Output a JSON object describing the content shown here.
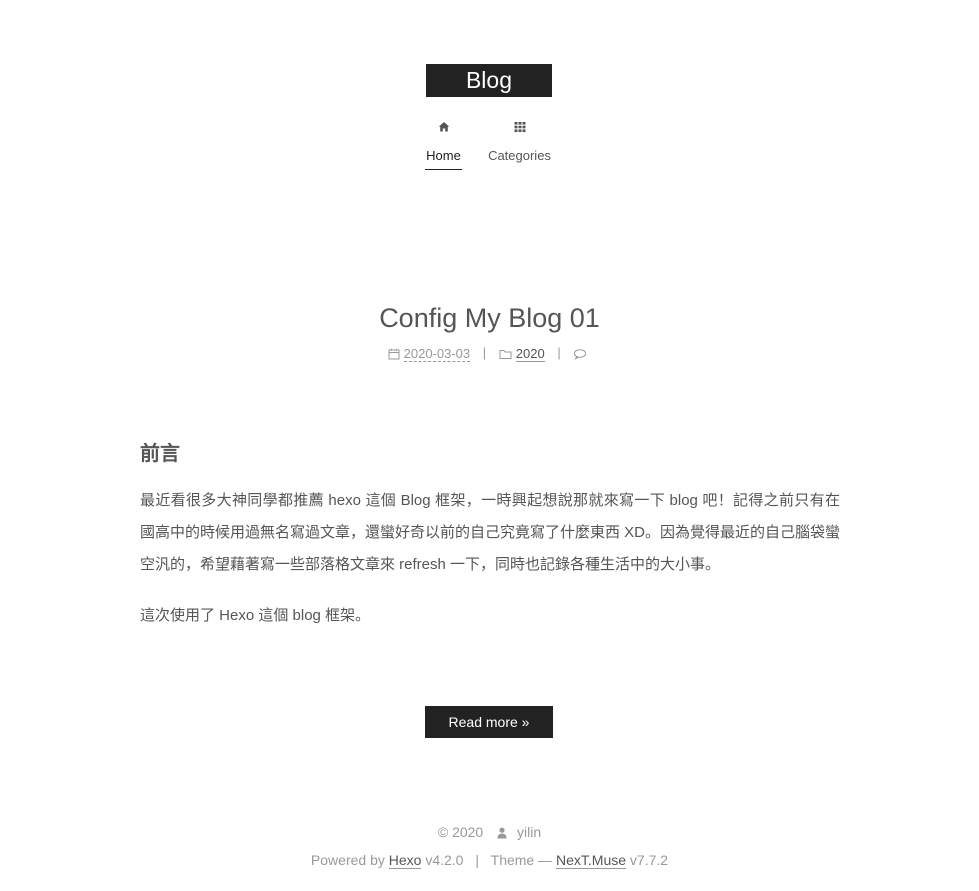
{
  "site": {
    "brand": "Blog"
  },
  "nav": {
    "items": [
      {
        "label": "Home",
        "icon": "home-icon"
      },
      {
        "label": "Categories",
        "icon": "grid-icon"
      }
    ]
  },
  "post": {
    "title": "Config My Blog 01",
    "date": "2020-03-03",
    "category": "2020",
    "heading": "前言",
    "paragraphs": [
      "最近看很多大神同學都推薦 hexo 這個 Blog 框架，一時興起想說那就來寫一下 blog 吧！記得之前只有在國高中的時候用過無名寫過文章，還蠻好奇以前的自己究竟寫了什麼東西 XD。因為覺得最近的自己腦袋蠻空汎的，希望藉著寫一些部落格文章來 refresh 一下，同時也記錄各種生活中的大小事。",
      "這次使用了 Hexo 這個 blog 框架。"
    ],
    "read_more": "Read more »"
  },
  "footer": {
    "copyright": "© 2020",
    "author": "yilin",
    "powered_by": "Powered by",
    "hexo_link": "Hexo",
    "hexo_version": "v4.2.0",
    "sep": "|",
    "theme_label": "Theme —",
    "theme_link": "NexT.Muse",
    "theme_version": "v7.7.2"
  },
  "colors": {
    "accent": "#222222",
    "text": "#555555",
    "muted": "#999999"
  }
}
